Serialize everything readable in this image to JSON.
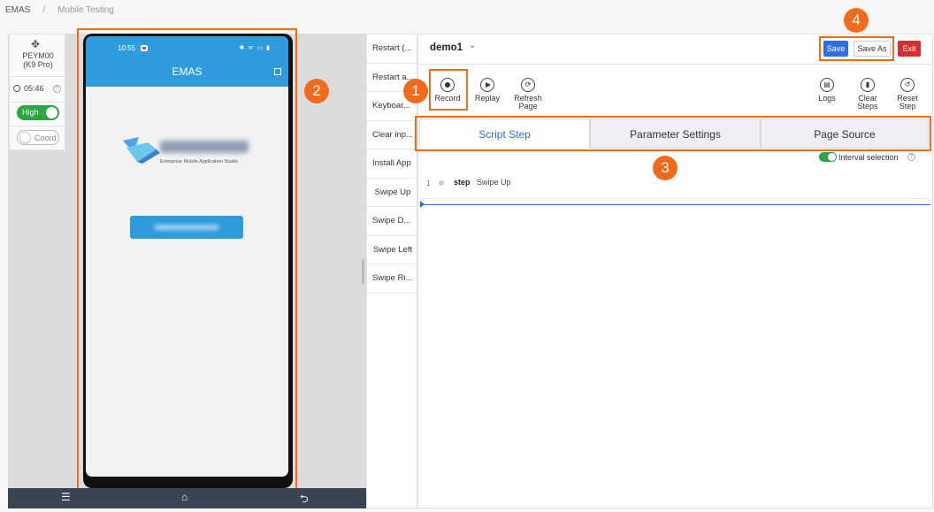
{
  "breadcrumb": {
    "root": "EMAS",
    "separator": "/",
    "current": "Mobile Testing"
  },
  "device": {
    "model": "PEYM00",
    "model_sub": "(K9 Pro)",
    "duration": "05:46",
    "quality_toggle": {
      "label": "High",
      "on": true
    },
    "coord_toggle": {
      "label": "Coord",
      "on": false
    }
  },
  "phone_screen": {
    "status_time": "10:55",
    "status_icons": "✱ ᯤ ▭ ▮",
    "app_title": "EMAS",
    "logo_subtitle": "Enterprise Mobile Application Studio"
  },
  "navbar": {
    "menu": "☰",
    "home": "⌂",
    "back": "⮌"
  },
  "quick_actions": [
    "Restart (...",
    "Restart a...",
    "Keyboar...",
    "Clear inp...",
    "Install App",
    "Swipe Up",
    "Swipe D...",
    "Swipe Left",
    "Swipe Ri..."
  ],
  "script": {
    "name": "demo1",
    "chevron": "⌄"
  },
  "buttons": {
    "save": "Save",
    "save_as": "Save As",
    "exit": "Exit"
  },
  "toolbar": {
    "record": "Record",
    "replay": "Replay",
    "refresh_page": "Refresh Page",
    "logs": "Logs",
    "clear_steps": "Clear Steps",
    "reset_step": "Reset Step"
  },
  "tabs": [
    "Script Step",
    "Parameter Settings",
    "Page Source"
  ],
  "interval_selection": {
    "label": "Interval selection",
    "on": true
  },
  "steps": [
    {
      "index": "1",
      "keyword": "step",
      "value": "Swipe Up"
    }
  ],
  "annotations": [
    "1",
    "2",
    "3",
    "4"
  ],
  "colors": {
    "accent": "#f26b1d",
    "primary": "#2f6fe4",
    "danger": "#d92d2d",
    "app_bar": "#2e9bdc",
    "toggle_on": "#27a844"
  }
}
